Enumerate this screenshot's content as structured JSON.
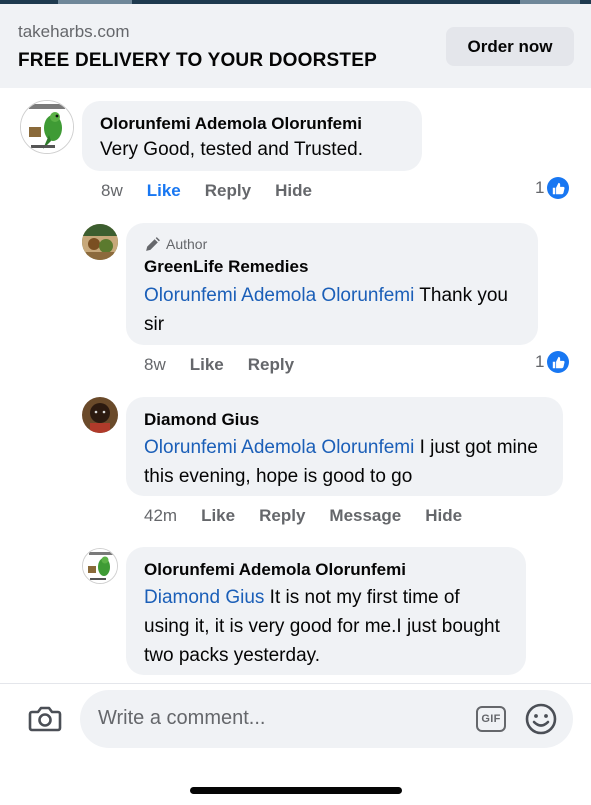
{
  "ad": {
    "domain": "takeharbs.com",
    "headline": "FREE DELIVERY TO YOUR DOORSTEP",
    "cta": "Order now"
  },
  "comments": [
    {
      "author": "Olorunfemi Ademola Olorunfemi",
      "text": "Very Good, tested and Trusted.",
      "actions": {
        "time": "8w",
        "like": "Like",
        "reply": "Reply",
        "hide": "Hide"
      },
      "like_count": "1"
    },
    {
      "badge": "Author",
      "author": "GreenLife Remedies",
      "mention": "Olorunfemi Ademola Olorunfemi",
      "text": " Thank you sir",
      "actions": {
        "time": "8w",
        "like": "Like",
        "reply": "Reply"
      },
      "like_count": "1"
    },
    {
      "author": "Diamond Gius",
      "mention": "Olorunfemi Ademola Olorunfemi",
      "text": " I just got mine this evening, hope is good to go",
      "actions": {
        "time": "42m",
        "like": "Like",
        "reply": "Reply",
        "message": "Message",
        "hide": "Hide"
      }
    },
    {
      "author": "Olorunfemi Ademola Olorunfemi",
      "mention": "Diamond Gius",
      "text": " It is not my first time of using it, it is very good for me.I just bought two packs yesterday."
    }
  ],
  "composer": {
    "placeholder": "Write a comment...",
    "gif_label": "GIF"
  },
  "icons": {
    "camera": "camera-icon",
    "gif": "gif-icon",
    "emoji": "emoji-icon",
    "like": "thumbs-up-icon",
    "author_badge": "pen-icon"
  },
  "colors": {
    "accent": "#1877f2",
    "mention": "#1b5fb8",
    "bubble": "#f0f2f5",
    "muted_text": "#65676b"
  }
}
